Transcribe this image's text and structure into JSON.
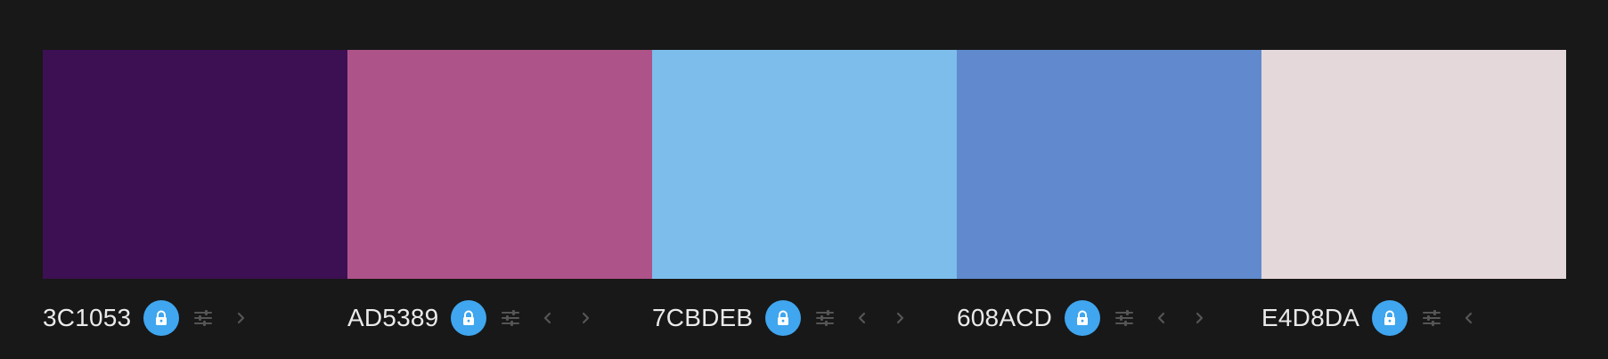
{
  "theme": {
    "background": "#181818",
    "accent": "#3FA6EF",
    "muted_icon": "#555555",
    "text": "#EAEAEA"
  },
  "palette": {
    "colors": [
      {
        "hex": "3C1053",
        "swatch": "#3C1053",
        "locked": true,
        "arrows": [
          "right"
        ]
      },
      {
        "hex": "AD5389",
        "swatch": "#AD5389",
        "locked": true,
        "arrows": [
          "left",
          "right"
        ]
      },
      {
        "hex": "7CBDEB",
        "swatch": "#7CBDEB",
        "locked": true,
        "arrows": [
          "left",
          "right"
        ]
      },
      {
        "hex": "608ACD",
        "swatch": "#608ACD",
        "locked": true,
        "arrows": [
          "left",
          "right"
        ]
      },
      {
        "hex": "E4D8DA",
        "swatch": "#E4D8DA",
        "locked": true,
        "arrows": [
          "left"
        ]
      }
    ]
  },
  "icons": {
    "lock": "lock-icon",
    "adjust": "sliders-icon",
    "left": "chevron-left-icon",
    "right": "chevron-right-icon"
  }
}
